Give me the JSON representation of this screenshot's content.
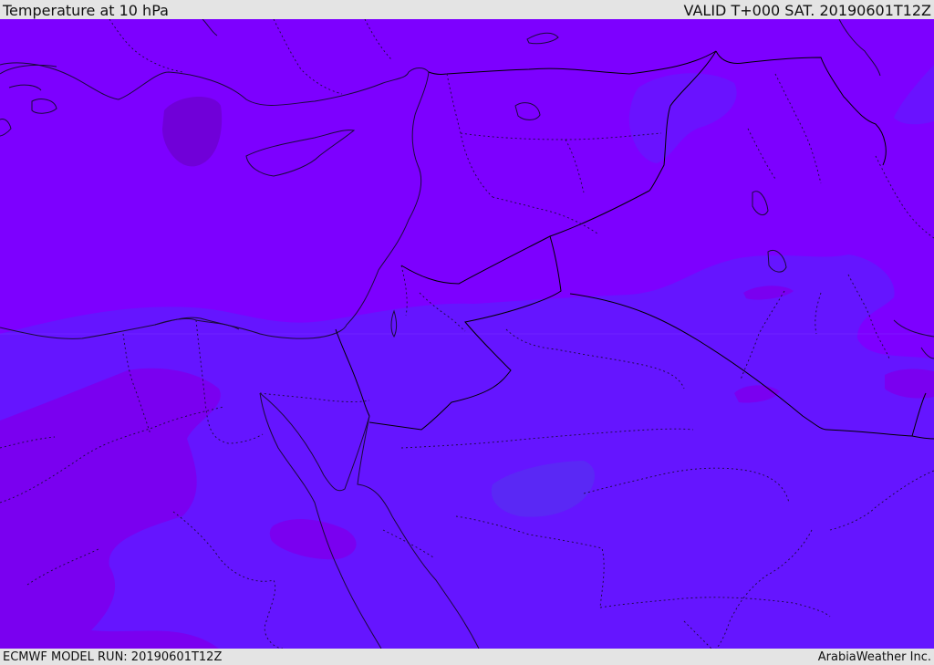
{
  "header": {
    "title": "Temperature at 10 hPa",
    "valid": "VALID T+000 SAT. 20190601T12Z"
  },
  "footer": {
    "model_run": "ECMWF MODEL RUN: 20190601T12Z",
    "credit": "ArabiaWeather Inc."
  },
  "colors": {
    "band_warm": "#7d00ff",
    "band_mid": "#6515ff",
    "band_cool": "#5a28f5",
    "cold_spot": "#7000d8",
    "warm_spot": "#7a00f0",
    "coastline": "#1a0a3a",
    "border": "#000000",
    "header_bg": "#e4e4e4"
  }
}
